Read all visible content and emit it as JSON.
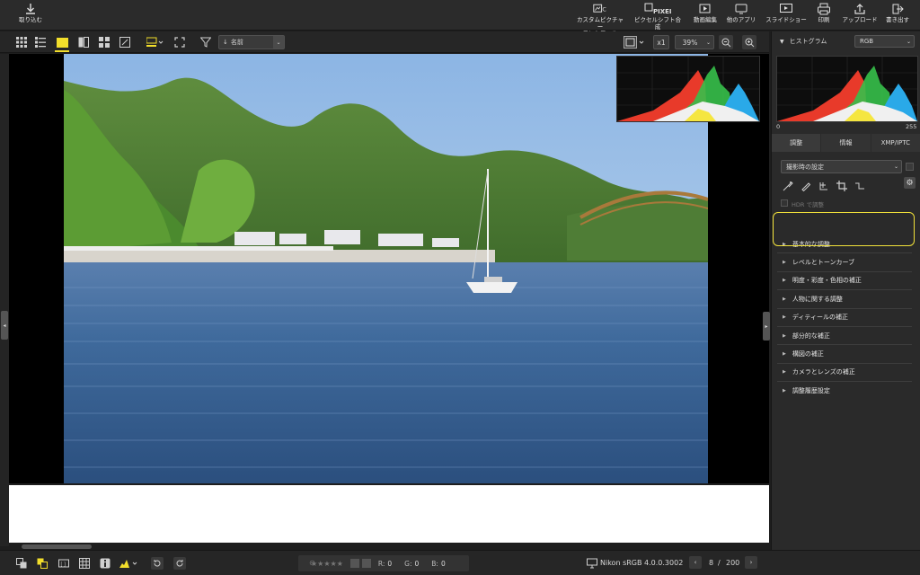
{
  "toolbar": {
    "import_label": "取り込む",
    "items": [
      {
        "name": "custom-picture-control",
        "label": "カスタムピクチャー\nコントロール"
      },
      {
        "name": "pixel-shift",
        "label": "ピクセルシフト合成"
      },
      {
        "name": "video-edit",
        "label": "動画編集"
      },
      {
        "name": "other-apps",
        "label": "他のアプリ"
      },
      {
        "name": "slideshow",
        "label": "スライドショー"
      },
      {
        "name": "print",
        "label": "印刷"
      },
      {
        "name": "upload",
        "label": "アップロード"
      },
      {
        "name": "export",
        "label": "書き出す"
      }
    ],
    "pixel_icon_text": "PIXEL"
  },
  "subbar": {
    "sort_label": "名前",
    "zoom_multiplier": "x1",
    "zoom_percent": "39%"
  },
  "panel": {
    "histogram_title": "ヒストグラム",
    "channel": "RGB",
    "hist_min": "0",
    "hist_max": "255",
    "tabs": [
      "調整",
      "情報",
      "XMP/IPTC"
    ],
    "preset": "撮影時の設定",
    "hdr_label": "HDR で調整",
    "adjustments": [
      "基本的な調整",
      "レベルとトーンカーブ",
      "明度・彩度・色相の補正",
      "人物に関する調整",
      "ディティールの補正",
      "部分的な補正",
      "構図の補正",
      "カメラとレンズの補正",
      "調整履歴設定"
    ]
  },
  "status": {
    "r_label": "R:",
    "r_value": "0",
    "g_label": "G:",
    "g_value": "0",
    "b_label": "B:",
    "b_value": "0",
    "stars": "★★★★★",
    "color_profile": "Nikon sRGB 4.0.0.3002",
    "page_current": "8",
    "page_sep": "/",
    "page_total": "200"
  },
  "colors": {
    "accent": "#f2de2b",
    "background": "#1e1e1e",
    "panel": "#2a2a2a"
  }
}
